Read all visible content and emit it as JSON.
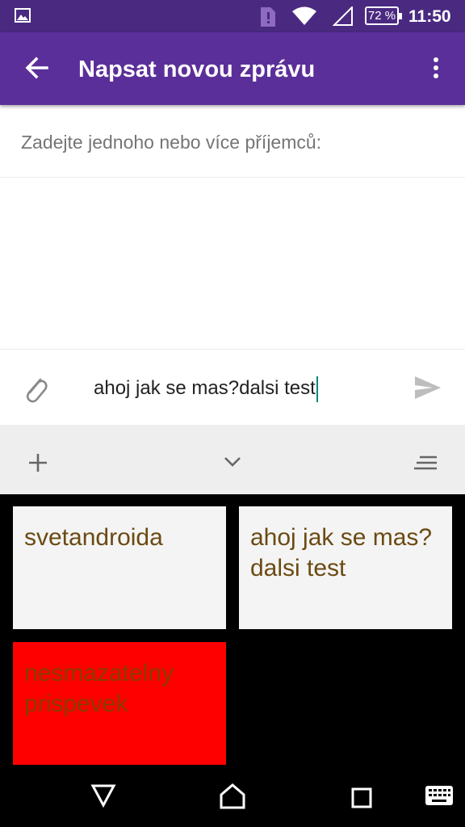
{
  "status_bar": {
    "battery": "72 %",
    "time": "11:50"
  },
  "app_bar": {
    "title": "Napsat novou zprávu"
  },
  "recipients": {
    "placeholder": "Zadejte jednoho nebo více příjemců:"
  },
  "compose": {
    "message": "ahoj jak se mas?dalsi test"
  },
  "clipboard": {
    "items": [
      {
        "text": "svetandroida"
      },
      {
        "text": "ahoj jak se mas?dalsi test"
      },
      {
        "text": "nesmazatelny prispevek"
      }
    ]
  },
  "icons": {
    "status": [
      "gallery-icon",
      "sim-icon",
      "wifi-icon",
      "signal-icon",
      "battery-icon"
    ],
    "app_bar": [
      "arrow-back-icon",
      "more-vert-icon"
    ],
    "compose": [
      "paperclip-icon",
      "send-icon"
    ],
    "keyboard_toolbar": [
      "plus-icon",
      "chevron-down-icon",
      "menu-lines-icon"
    ],
    "navigation": [
      "nav-back-icon",
      "nav-home-icon",
      "nav-recents-icon",
      "keyboard-icon"
    ]
  },
  "colors": {
    "status_bar": "#4a2a80",
    "app_bar": "#5b2f99",
    "caret": "#00897b",
    "clip_text": "#6b4a12",
    "clip_card": "#f4f4f4",
    "clip_card_pinned": "#ff0000"
  }
}
